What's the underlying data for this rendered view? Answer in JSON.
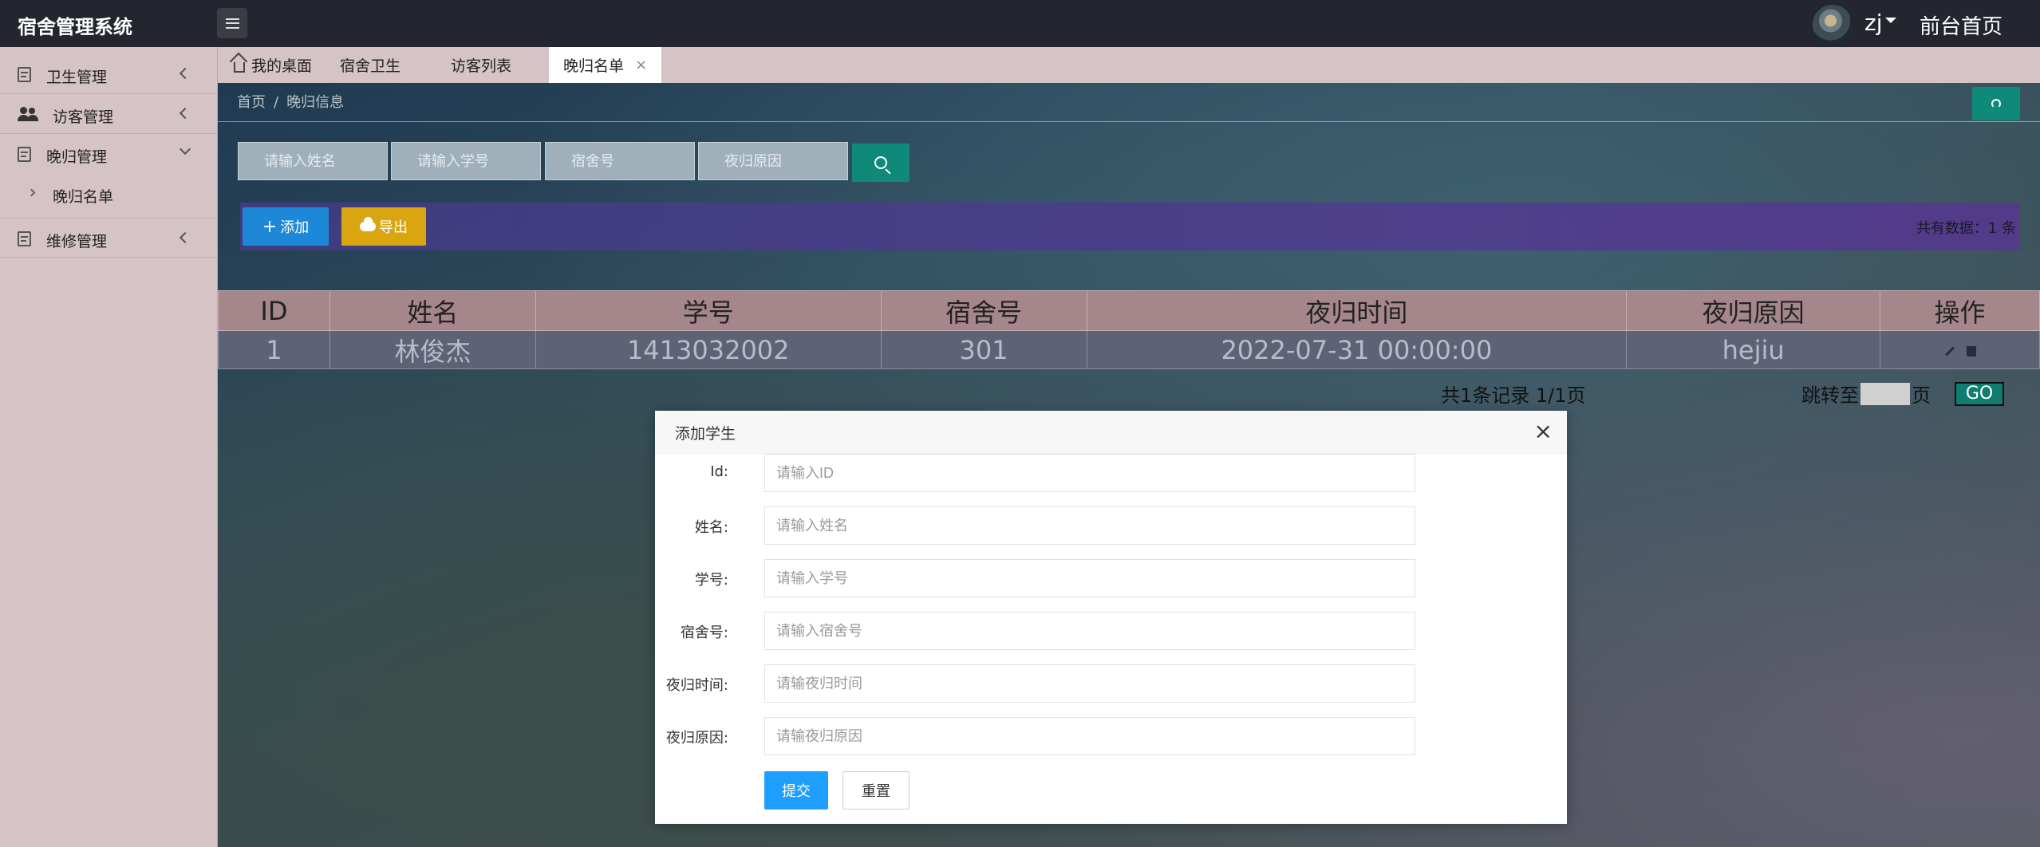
{
  "header": {
    "app_title": "宿舍管理系统",
    "user_name": "zj",
    "front_home": "前台首页"
  },
  "sidebar": {
    "items": [
      {
        "label": "卫生管理",
        "icon": "document-icon"
      },
      {
        "label": "访客管理",
        "icon": "users-icon"
      },
      {
        "label": "晚归管理",
        "icon": "document-icon"
      },
      {
        "label": "维修管理",
        "icon": "document-icon"
      }
    ],
    "sub_items": [
      {
        "label": "晚归名单"
      }
    ]
  },
  "tabs": [
    {
      "label": "我的桌面"
    },
    {
      "label": "宿舍卫生"
    },
    {
      "label": "访客列表"
    },
    {
      "label": "晚归名单",
      "close": "×"
    }
  ],
  "breadcrumb": {
    "home": "首页",
    "separator": "/",
    "current": "晚归信息"
  },
  "search": {
    "name_placeholder": "请输入姓名",
    "student_id_placeholder": "请输入学号",
    "dorm_placeholder": "宿舍号",
    "reason_placeholder": "夜归原因"
  },
  "toolbar": {
    "add_label": "添加",
    "export_label": "导出",
    "total_text": "共有数据：1 条"
  },
  "table": {
    "headers": [
      "ID",
      "姓名",
      "学号",
      "宿舍号",
      "夜归时间",
      "夜归原因",
      "操作"
    ],
    "rows": [
      [
        "1",
        "林俊杰",
        "1413032002",
        "301",
        "2022-07-31 00:00:00",
        "hejiu"
      ]
    ]
  },
  "pager": {
    "info": "共1条记录  1/1页",
    "jump_prefix": "跳转至",
    "jump_suffix": "页",
    "go_label": "GO"
  },
  "modal": {
    "title": "添加学生",
    "close": "×",
    "fields": [
      {
        "label": "Id:",
        "placeholder": "请输入ID"
      },
      {
        "label": "姓名:",
        "placeholder": "请输入姓名"
      },
      {
        "label": "学号:",
        "placeholder": "请输入学号"
      },
      {
        "label": "宿舍号:",
        "placeholder": "请输入宿舍号"
      },
      {
        "label": "夜归时间:",
        "placeholder": "请输夜归时间"
      },
      {
        "label": "夜归原因:",
        "placeholder": "请输夜归原因"
      }
    ],
    "submit_label": "提交",
    "reset_label": "重置"
  },
  "colors": {
    "header_bg": "#23262e",
    "sidebar_bg": "#d5c3c6",
    "accent_teal": "#0f8a7a",
    "add_blue": "#1e88d8",
    "export_yellow": "#d9a612",
    "submit_blue": "#1e9fff"
  }
}
